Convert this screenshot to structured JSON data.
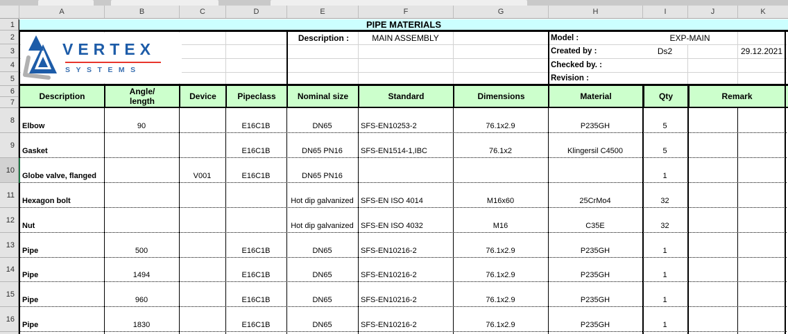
{
  "sheet": {
    "column_letters": [
      "A",
      "B",
      "C",
      "D",
      "E",
      "F",
      "G",
      "H",
      "I",
      "J",
      "K"
    ],
    "row_numbers": [
      "1",
      "2",
      "3",
      "4",
      "5",
      "6",
      "7",
      "8",
      "9",
      "10",
      "11",
      "12",
      "13",
      "14",
      "15",
      "16"
    ],
    "active_row": "10"
  },
  "title": "PIPE MATERIALS",
  "logo": {
    "brand": "VERTEX",
    "tagline": "SYSTEMS"
  },
  "info": {
    "description_label": "Description :",
    "description_value": "MAIN ASSEMBLY",
    "model_label": "Model :",
    "model_value": "EXP-MAIN",
    "created_label": "Created by :",
    "created_value": "Ds2",
    "created_date": "29.12.2021",
    "checked_label": "Checked by. :",
    "revision_label": "Revision :"
  },
  "table": {
    "headers": {
      "description": "Description",
      "angle_length": "Angle/\nlength",
      "device": "Device",
      "pipeclass": "Pipeclass",
      "nominal_size": "Nominal size",
      "standard": "Standard",
      "dimensions": "Dimensions",
      "material": "Material",
      "qty": "Qty",
      "remark": "Remark"
    },
    "rows": [
      {
        "description": "Elbow",
        "angle_length": "90",
        "device": "",
        "pipeclass": "E16C1B",
        "nominal_size": "DN65",
        "standard": "SFS-EN10253-2",
        "dimensions": "76.1x2.9",
        "material": "P235GH",
        "qty": "5",
        "remark_j": "",
        "remark_k": ""
      },
      {
        "description": "Gasket",
        "angle_length": "",
        "device": "",
        "pipeclass": "E16C1B",
        "nominal_size": "DN65 PN16",
        "standard": "SFS-EN1514-1,IBC",
        "dimensions": "76.1x2",
        "material": "Klingersil C4500",
        "qty": "5",
        "remark_j": "",
        "remark_k": ""
      },
      {
        "description": "Globe valve, flanged",
        "angle_length": "",
        "device": "V001",
        "pipeclass": "E16C1B",
        "nominal_size": "DN65 PN16",
        "standard": "",
        "dimensions": "",
        "material": "",
        "qty": "1",
        "remark_j": "",
        "remark_k": ""
      },
      {
        "description": "Hexagon bolt",
        "angle_length": "",
        "device": "",
        "pipeclass": "",
        "nominal_size": "Hot dip galvanized",
        "standard": "SFS-EN ISO 4014",
        "dimensions": "M16x60",
        "material": "25CrMo4",
        "qty": "32",
        "remark_j": "",
        "remark_k": ""
      },
      {
        "description": "Nut",
        "angle_length": "",
        "device": "",
        "pipeclass": "",
        "nominal_size": "Hot dip galvanized",
        "standard": "SFS-EN ISO 4032",
        "dimensions": "M16",
        "material": "C35E",
        "qty": "32",
        "remark_j": "",
        "remark_k": ""
      },
      {
        "description": "Pipe",
        "angle_length": "500",
        "device": "",
        "pipeclass": "E16C1B",
        "nominal_size": "DN65",
        "standard": "SFS-EN10216-2",
        "dimensions": "76.1x2.9",
        "material": "P235GH",
        "qty": "1",
        "remark_j": "",
        "remark_k": ""
      },
      {
        "description": "Pipe",
        "angle_length": "1494",
        "device": "",
        "pipeclass": "E16C1B",
        "nominal_size": "DN65",
        "standard": "SFS-EN10216-2",
        "dimensions": "76.1x2.9",
        "material": "P235GH",
        "qty": "1",
        "remark_j": "",
        "remark_k": ""
      },
      {
        "description": "Pipe",
        "angle_length": "960",
        "device": "",
        "pipeclass": "E16C1B",
        "nominal_size": "DN65",
        "standard": "SFS-EN10216-2",
        "dimensions": "76.1x2.9",
        "material": "P235GH",
        "qty": "1",
        "remark_j": "",
        "remark_k": ""
      },
      {
        "description": "Pipe",
        "angle_length": "1830",
        "device": "",
        "pipeclass": "E16C1B",
        "nominal_size": "DN65",
        "standard": "SFS-EN10216-2",
        "dimensions": "76.1x2.9",
        "material": "P235GH",
        "qty": "1",
        "remark_j": "",
        "remark_k": ""
      }
    ]
  },
  "colors": {
    "title_bg": "#CCFFFF",
    "table_header_bg": "#CCFFCC",
    "logo_blue": "#1D5CA8",
    "logo_red": "#E8352B",
    "active_cell_green": "#1F7244"
  }
}
